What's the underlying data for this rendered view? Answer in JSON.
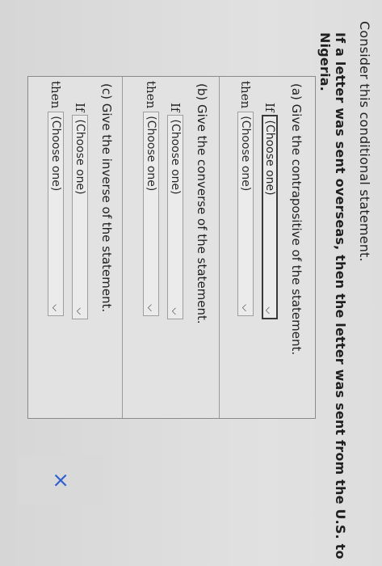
{
  "intro": "Consider this conditional statement.",
  "statement": "If a letter was sent overseas, then the letter was sent from the U.S. to Nigeria.",
  "close_icon": "×",
  "questions": [
    {
      "title": "(a) Give the contrapositive of the statement.",
      "if_label": "If",
      "if_select": "(Choose one)",
      "then_label": "then",
      "then_select": "(Choose one)"
    },
    {
      "title": "(b) Give the converse of the statement.",
      "if_label": "If",
      "if_select": "(Choose one)",
      "then_label": "then",
      "then_select": "(Choose one)"
    },
    {
      "title": "(c) Give the inverse of the statement.",
      "if_label": "If",
      "if_select": "(Choose one)",
      "then_label": "then",
      "then_select": "(Choose one)"
    }
  ]
}
